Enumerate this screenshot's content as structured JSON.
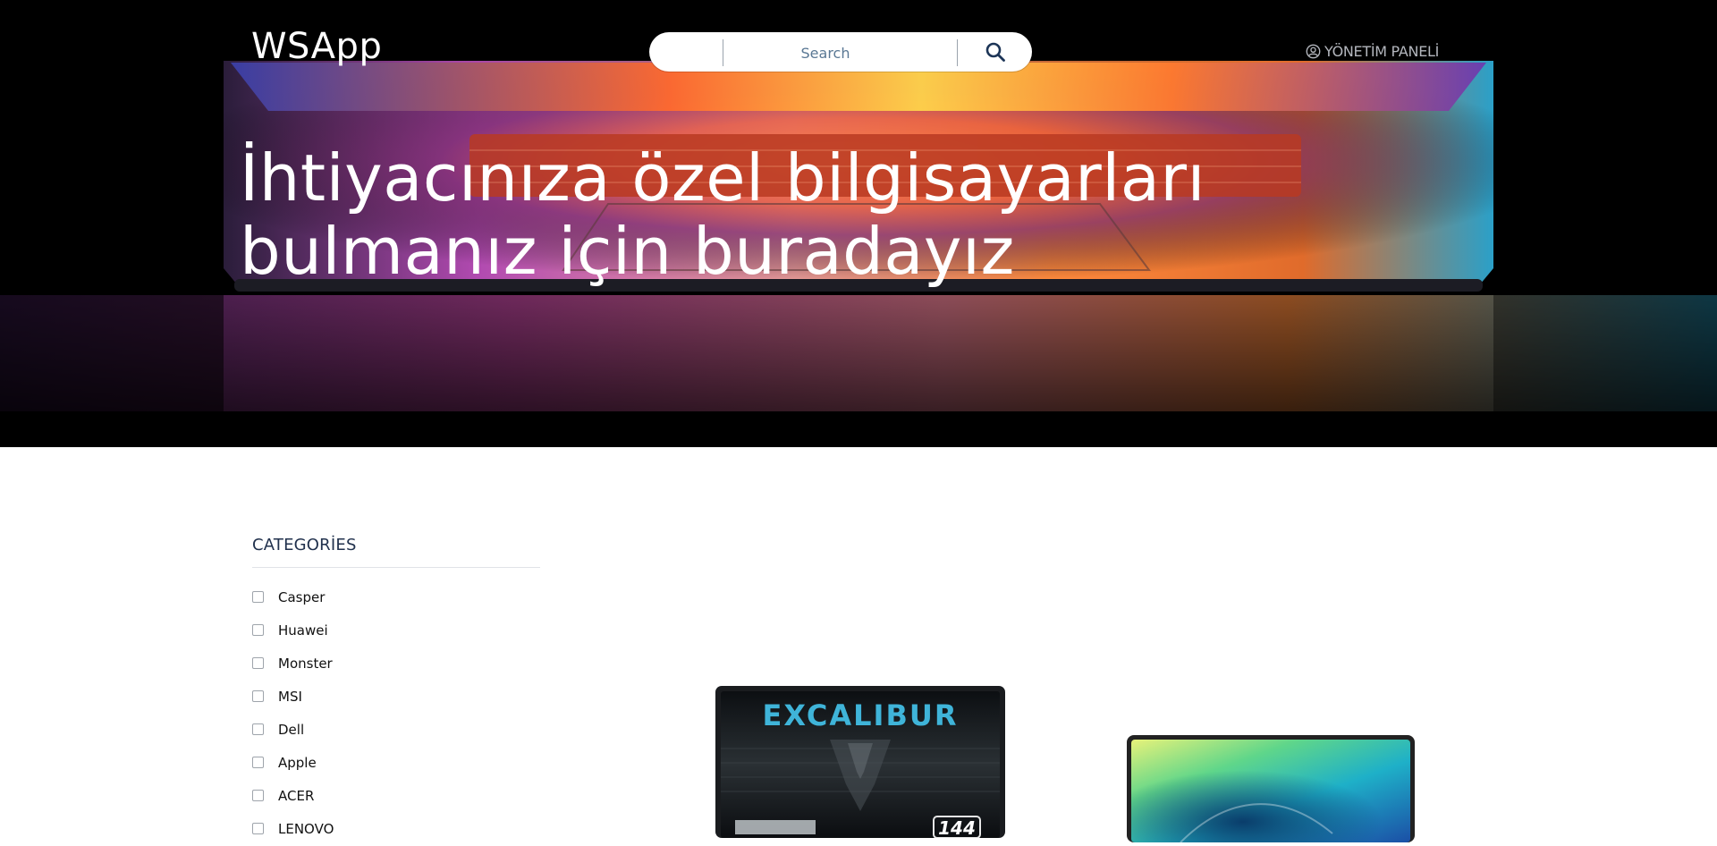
{
  "brand": {
    "logo": "WSApp"
  },
  "search": {
    "placeholder": "Search"
  },
  "nav": {
    "admin_label": "YÖNETİM PANELİ"
  },
  "hero": {
    "headline_line1": "İhtiyacınıza özel bilgisayarları",
    "headline_line2": "bulmanız için buradayız"
  },
  "categories": {
    "title": "CATEGORİES",
    "items": [
      {
        "label": "Casper",
        "checked": false
      },
      {
        "label": "Huawei",
        "checked": false
      },
      {
        "label": "Monster",
        "checked": false
      },
      {
        "label": "MSI",
        "checked": false
      },
      {
        "label": "Dell",
        "checked": false
      },
      {
        "label": "Apple",
        "checked": false
      },
      {
        "label": "ACER",
        "checked": false
      },
      {
        "label": "LENOVO",
        "checked": false
      }
    ]
  },
  "products": [
    {
      "brand_text": "EXCALIBUR",
      "badge": "144",
      "image": "monster-laptop-image"
    },
    {
      "image": "huawei-laptop-image"
    }
  ],
  "colors": {
    "hero_bg": "#000000",
    "headline": "#ffffff",
    "category_title": "#21314d",
    "excalibur_text": "#3fb4d9"
  }
}
